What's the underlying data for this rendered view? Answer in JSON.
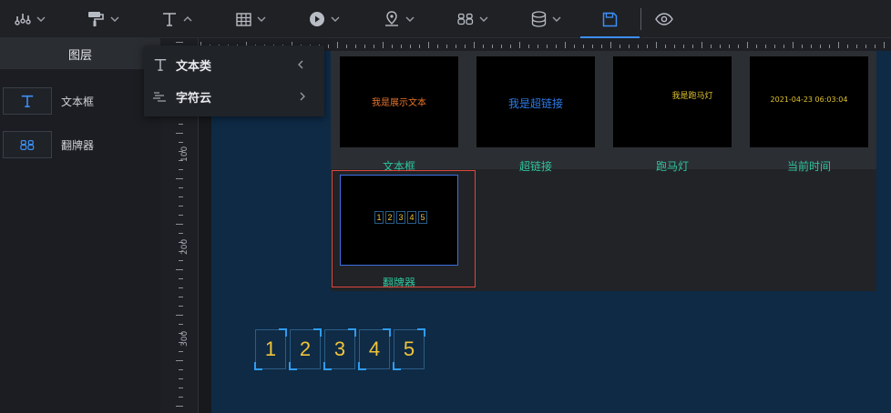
{
  "toolbar": {
    "buttons": [
      {
        "id": "chart",
        "icon": "bar-chart-icon"
      },
      {
        "id": "decor",
        "icon": "paint-roller-icon"
      },
      {
        "id": "text",
        "icon": "text-t-icon",
        "open": true
      },
      {
        "id": "table",
        "icon": "table-icon"
      },
      {
        "id": "media",
        "icon": "play-circle-icon"
      },
      {
        "id": "map",
        "icon": "map-pin-icon"
      },
      {
        "id": "counter",
        "icon": "digits-88-icon"
      },
      {
        "id": "data",
        "icon": "database-icon"
      },
      {
        "id": "save",
        "icon": "save-icon",
        "active": true
      },
      {
        "id": "preview",
        "icon": "eye-icon"
      }
    ],
    "accent_color": "#3d8ef5"
  },
  "layer_panel": {
    "title": "图层",
    "items": [
      {
        "label": "文本框",
        "icon": "text-t-icon"
      },
      {
        "label": "翻牌器",
        "icon": "digits-88-icon"
      }
    ]
  },
  "ruler": {
    "vertical_labels": [
      "100",
      "200",
      "300"
    ]
  },
  "text_menu": {
    "items": [
      {
        "label": "文本类",
        "arrow": "chevron-left-icon"
      },
      {
        "label": "字符云",
        "arrow": "chevron-right-icon"
      }
    ]
  },
  "components": {
    "cards": [
      {
        "name": "文本框",
        "preview_text": "我是展示文本",
        "preview_color": "#e8752a"
      },
      {
        "name": "超链接",
        "preview_text": "我是超链接",
        "preview_color": "#2d7be8"
      },
      {
        "name": "跑马灯",
        "preview_text": "我是跑马灯",
        "preview_color": "#e0c22e"
      },
      {
        "name": "当前时间",
        "preview_text": "2021-04-23 06:03:04",
        "preview_color": "#e0c22e"
      },
      {
        "name": "翻牌器",
        "preview_digits": [
          "1",
          "2",
          "3",
          "4",
          "5"
        ],
        "selected": true
      }
    ],
    "name_color": "#2fc49c"
  },
  "canvas": {
    "background": "#0e2a45",
    "flip_counter": {
      "digits": [
        "1",
        "2",
        "3",
        "4",
        "5"
      ],
      "digit_color": "#f0c43a"
    }
  }
}
